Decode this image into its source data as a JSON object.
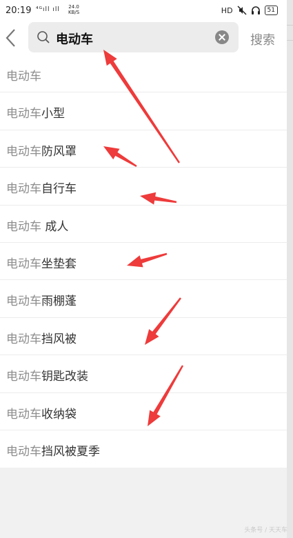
{
  "status_bar": {
    "time": "20:19",
    "signal_text": "⁴ᴳıll ıll",
    "net_speed_value": "24.0",
    "net_speed_unit": "KB/S",
    "hd_label": "HD",
    "battery_level": "51",
    "icons": [
      "hd-icon",
      "mute-icon",
      "headphones-icon",
      "battery-icon"
    ]
  },
  "search": {
    "query": "电动车",
    "submit_label": "搜索"
  },
  "suggestions": [
    {
      "prefix": "电动车",
      "suffix": ""
    },
    {
      "prefix": "电动车",
      "suffix": "小型"
    },
    {
      "prefix": "电动车",
      "suffix": "防风罩"
    },
    {
      "prefix": "电动车",
      "suffix": "自行车"
    },
    {
      "prefix": "电动车",
      "suffix": " 成人"
    },
    {
      "prefix": "电动车",
      "suffix": "坐垫套"
    },
    {
      "prefix": "电动车",
      "suffix": "雨棚蓬"
    },
    {
      "prefix": "电动车",
      "suffix": "挡风被"
    },
    {
      "prefix": "电动车",
      "suffix": "钥匙改装"
    },
    {
      "prefix": "电动车",
      "suffix": "收纳袋"
    },
    {
      "prefix": "电动车",
      "suffix": "挡风被夏季"
    }
  ],
  "annotation_color": "#ee3b3b",
  "watermark": "头条号 / 天天车"
}
